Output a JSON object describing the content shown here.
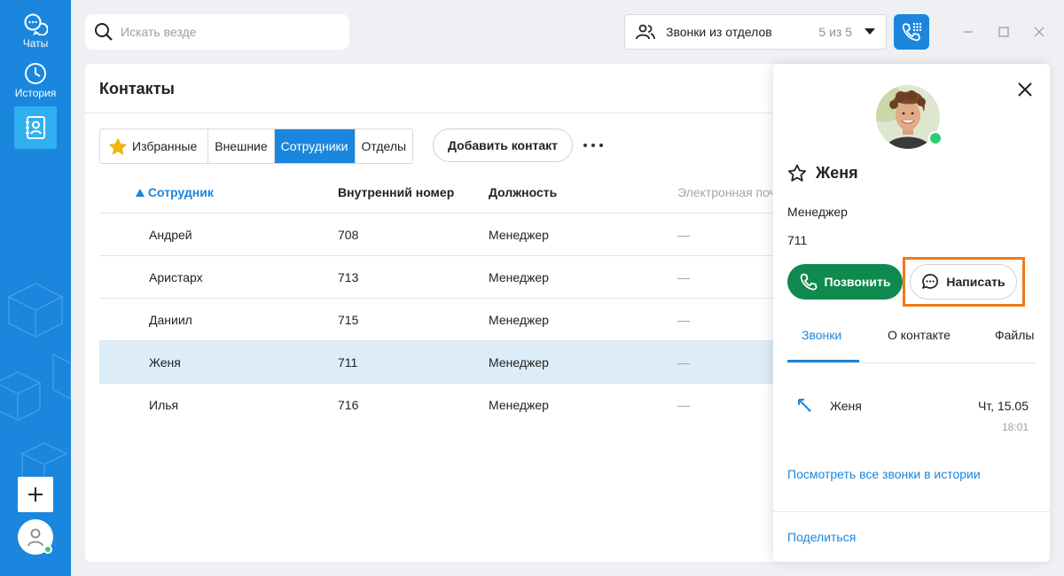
{
  "sidebar": {
    "items": [
      {
        "label": "Чаты",
        "icon": "chats-icon"
      },
      {
        "label": "История",
        "icon": "history-clock-icon"
      },
      {
        "label": "",
        "icon": "contacts-book-icon"
      }
    ],
    "add_icon": "plus-icon",
    "avatar_icon": "user-icon"
  },
  "topbar": {
    "search_placeholder": "Искать везде",
    "dept_filter": {
      "label": "Звонки из отделов",
      "count": "5 из 5"
    },
    "window_controls": [
      "minimize-icon",
      "maximize-icon",
      "close-icon"
    ]
  },
  "contacts": {
    "title": "Контакты",
    "filters": [
      {
        "label": "Избранные",
        "active": false
      },
      {
        "label": "Внешние",
        "active": false
      },
      {
        "label": "Сотрудники",
        "active": true
      },
      {
        "label": "Отделы",
        "active": false
      }
    ],
    "add_contact_label": "Добавить контакт",
    "columns": {
      "name": "Сотрудник",
      "ext": "Внутренний номер",
      "position": "Должность",
      "email": "Электронная поч"
    },
    "rows": [
      {
        "name": "Андрей",
        "ext": "708",
        "position": "Менеджер",
        "email": "—"
      },
      {
        "name": "Аристарх",
        "ext": "713",
        "position": "Менеджер",
        "email": "—"
      },
      {
        "name": "Даниил",
        "ext": "715",
        "position": "Менеджер",
        "email": "—"
      },
      {
        "name": "Женя",
        "ext": "711",
        "position": "Менеджер",
        "email": "—"
      },
      {
        "name": "Илья",
        "ext": "716",
        "position": "Менеджер",
        "email": "—"
      }
    ]
  },
  "panel": {
    "name": "Женя",
    "role": "Менеджер",
    "ext": "711",
    "call_label": "Позвонить",
    "write_label": "Написать",
    "tabs": [
      "Звонки",
      "О контакте",
      "Файлы"
    ],
    "recent_call": {
      "name": "Женя",
      "date": "Чт, 15.05",
      "time": "18:01"
    },
    "history_link": "Посмотреть все звонки в истории",
    "share_label": "Поделиться"
  },
  "colors": {
    "brand_blue": "#1a86dd",
    "call_green": "#0f8a4f",
    "highlight_orange": "#f07a1a",
    "online_green": "#2ecc71"
  }
}
